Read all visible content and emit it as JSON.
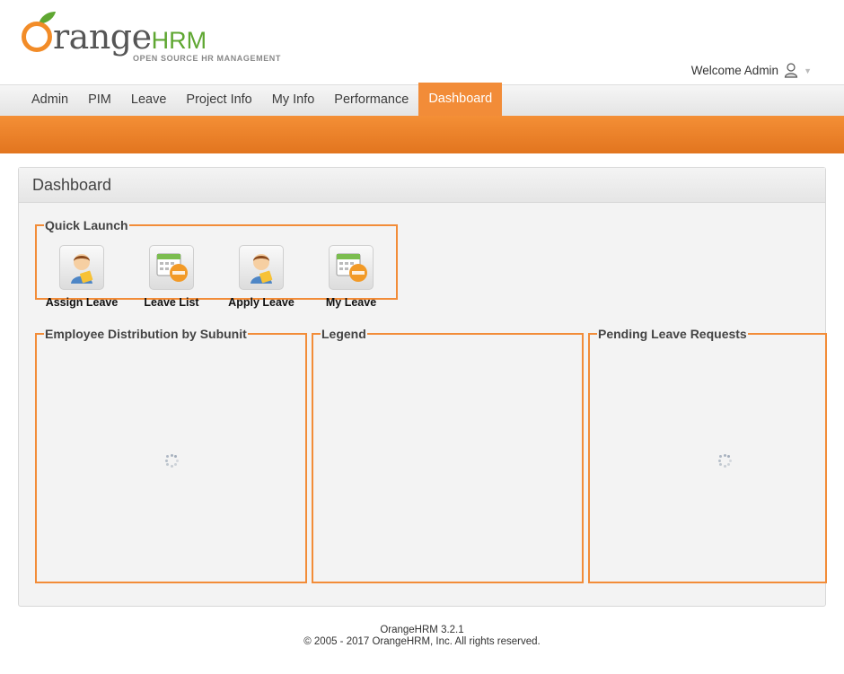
{
  "brand": {
    "name_part1": "range",
    "name_part2": "HRM",
    "tagline": "OPEN SOURCE HR MANAGEMENT",
    "orange": "#f28c38",
    "green": "#5fa732"
  },
  "header": {
    "welcome": "Welcome Admin",
    "user_icon": "user-icon",
    "dropdown_icon": "caret-down-icon"
  },
  "nav": {
    "items": [
      {
        "label": "Admin"
      },
      {
        "label": "PIM"
      },
      {
        "label": "Leave"
      },
      {
        "label": "Project Info"
      },
      {
        "label": "My Info"
      },
      {
        "label": "Performance"
      },
      {
        "label": "Dashboard",
        "active": true
      }
    ]
  },
  "dashboard": {
    "title": "Dashboard",
    "quick_launch": {
      "legend": "Quick Launch",
      "items": [
        {
          "label": "Assign Leave",
          "icon": "person-assign-icon"
        },
        {
          "label": "Leave List",
          "icon": "calendar-list-icon"
        },
        {
          "label": "Apply Leave",
          "icon": "person-apply-icon"
        },
        {
          "label": "My Leave",
          "icon": "calendar-my-icon"
        }
      ]
    },
    "panels": {
      "employee_distribution": "Employee Distribution by Subunit",
      "legend": "Legend",
      "pending_leave": "Pending Leave Requests"
    },
    "loading_icon": "spinner-icon"
  },
  "footer": {
    "version": "OrangeHRM 3.2.1",
    "copyright": "© 2005 - 2017 OrangeHRM, Inc. All rights reserved."
  }
}
